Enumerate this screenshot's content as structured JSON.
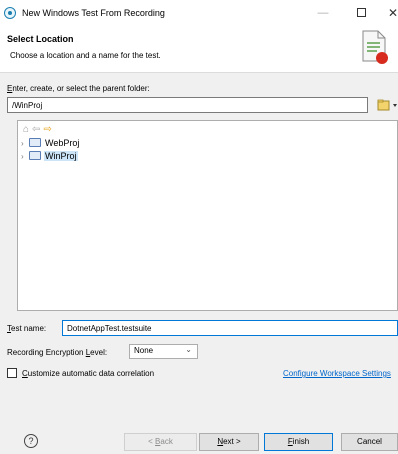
{
  "window": {
    "title": "New Windows Test From Recording"
  },
  "header": {
    "title": "Select Location",
    "description": "Choose a location and a name for the test."
  },
  "folder": {
    "label_underline": "E",
    "label_rest": "nter, create, or select the parent folder:",
    "value": "/WinProj"
  },
  "tree": {
    "nodes": [
      {
        "label": "WebProj",
        "selected": false
      },
      {
        "label": "WinProj",
        "selected": true
      }
    ]
  },
  "test_name": {
    "label_underline": "T",
    "label_rest": "est name:",
    "value": "DotnetAppTest.testsuite"
  },
  "encryption": {
    "label_pre": "Recording Encryption ",
    "label_underline": "L",
    "label_post": "evel:",
    "selected": "None"
  },
  "customize": {
    "label_underline": "C",
    "label_rest": "ustomize automatic data correlation",
    "checked": false
  },
  "workspace_link": "Configure Workspace Settings",
  "buttons": {
    "back_pre": "< ",
    "back_underline": "B",
    "back_rest": "ack",
    "next_underline": "N",
    "next_rest": "ext >",
    "finish_underline": "F",
    "finish_rest": "inish",
    "cancel": "Cancel"
  }
}
